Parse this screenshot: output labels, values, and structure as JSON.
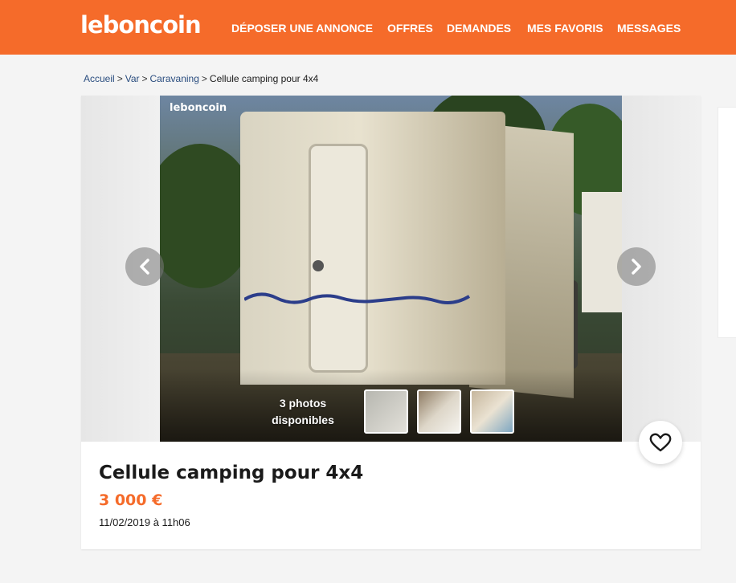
{
  "header": {
    "logo": "leboncoin",
    "nav": [
      "DÉPOSER UNE ANNONCE",
      "OFFRES",
      "DEMANDES",
      "MES FAVORIS",
      "MESSAGES"
    ]
  },
  "breadcrumb": {
    "items": [
      "Accueil",
      "Var",
      "Caravaning"
    ],
    "separator": ">",
    "current": "Cellule camping pour 4x4"
  },
  "gallery": {
    "watermark": "leboncoin",
    "photo_count_line1": "3 photos",
    "photo_count_line2": "disponibles",
    "thumbnail_count": 3
  },
  "listing": {
    "title": "Cellule camping pour 4x4",
    "price": "3 000 €",
    "date": "11/02/2019 à 11h06"
  },
  "icons": {
    "prev": "chevron-left-icon",
    "next": "chevron-right-icon",
    "favorite": "heart-icon"
  },
  "colors": {
    "brand": "#f56b2a",
    "link": "#2a4d7f",
    "background": "#f4f4f4"
  }
}
